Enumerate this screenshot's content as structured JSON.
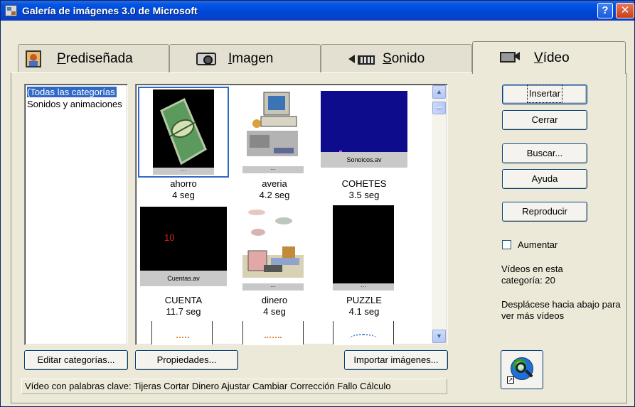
{
  "window": {
    "title": "Galería de imágenes 3.0 de Microsoft"
  },
  "titlebar_buttons": {
    "help": "?",
    "close": "✕"
  },
  "tabs": [
    {
      "label": "Prediseñada",
      "icon": "clipart-icon",
      "active": false
    },
    {
      "label": "Imagen",
      "icon": "camera-icon",
      "active": false
    },
    {
      "label": "Sonido",
      "icon": "speaker-icon",
      "active": false
    },
    {
      "label": "Vídeo",
      "icon": "video-camera-icon",
      "active": true
    }
  ],
  "categories": [
    {
      "label": "(Todas las categorías",
      "selected": true
    },
    {
      "label": "Sonidos y animaciones",
      "selected": false
    }
  ],
  "clips": [
    {
      "name": "ahorro",
      "duration": "4 seg",
      "selected": true
    },
    {
      "name": "averia",
      "duration": "4.2 seg",
      "selected": false
    },
    {
      "name": "COHETES",
      "duration": "3.5 seg",
      "selected": false,
      "bar_text": "Sonoicos.av"
    },
    {
      "name": "CUENTA",
      "duration": "11.7 seg",
      "selected": false,
      "bar_text": "Cuentas.av",
      "overlay_text": "10"
    },
    {
      "name": "dinero",
      "duration": "4 seg",
      "selected": false
    },
    {
      "name": "PUZZLE",
      "duration": "4.1 seg",
      "selected": false
    }
  ],
  "buttons": {
    "insert": "Insertar",
    "close": "Cerrar",
    "search": "Buscar...",
    "help": "Ayuda",
    "play": "Reproducir",
    "edit_categories": "Editar categorías...",
    "properties": "Propiedades...",
    "import": "Importar imágenes..."
  },
  "options": {
    "magnify_label": "Aumentar",
    "magnify_checked": false
  },
  "info": {
    "count_text": "Vídeos en esta categoría: 20",
    "scroll_hint": "Desplácese hacia abajo para ver más vídeos"
  },
  "status_text": "Vídeo con palabras clave:  Tijeras Cortar Dinero Ajustar Cambiar Corrección Fallo Cálculo",
  "colors": {
    "titlebar": "#0055e5",
    "selection": "#316ac5",
    "face": "#ece9d8"
  }
}
